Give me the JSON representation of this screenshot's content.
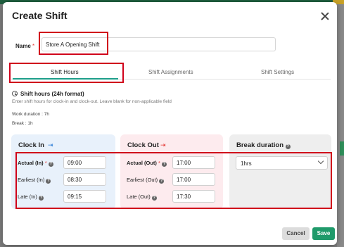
{
  "modal": {
    "title": "Create Shift"
  },
  "name": {
    "label": "Name",
    "required_mark": "*",
    "value": "Store A Opening Shift"
  },
  "tabs": [
    {
      "label": "Shift Hours",
      "active": true
    },
    {
      "label": "Shift Assignments",
      "active": false
    },
    {
      "label": "Shift Settings",
      "active": false
    }
  ],
  "shift_hours": {
    "title": "Shift hours (24h format)",
    "description": "Enter shift hours for clock-in and clock-out. Leave blank for non-applicable field",
    "work_duration": "Work duration : 7h",
    "break": "Break : 1h"
  },
  "clock_in": {
    "title": "Clock In",
    "rows": [
      {
        "label": "Actual (In)",
        "required_mark": "*",
        "value": "09:00"
      },
      {
        "label": "Earliest (In)",
        "value": "08:30"
      },
      {
        "label": "Late (In)",
        "value": "09:15"
      }
    ]
  },
  "clock_out": {
    "title": "Clock Out",
    "rows": [
      {
        "label": "Actual (Out)",
        "required_mark": "*",
        "value": "17:00"
      },
      {
        "label": "Earliest (Out)",
        "value": "17:00"
      },
      {
        "label": "Late (Out)",
        "value": "17:30"
      }
    ]
  },
  "break_duration": {
    "title": "Break duration",
    "selected": "1hrs"
  },
  "actions": {
    "cancel": "Cancel",
    "save": "Save"
  },
  "colors": {
    "accent": "#1e9e8a",
    "save": "#1f9a6a",
    "annotation": "#d0021b",
    "clock_in_bg": "#e8f1fb",
    "clock_out_bg": "#fdebee"
  }
}
